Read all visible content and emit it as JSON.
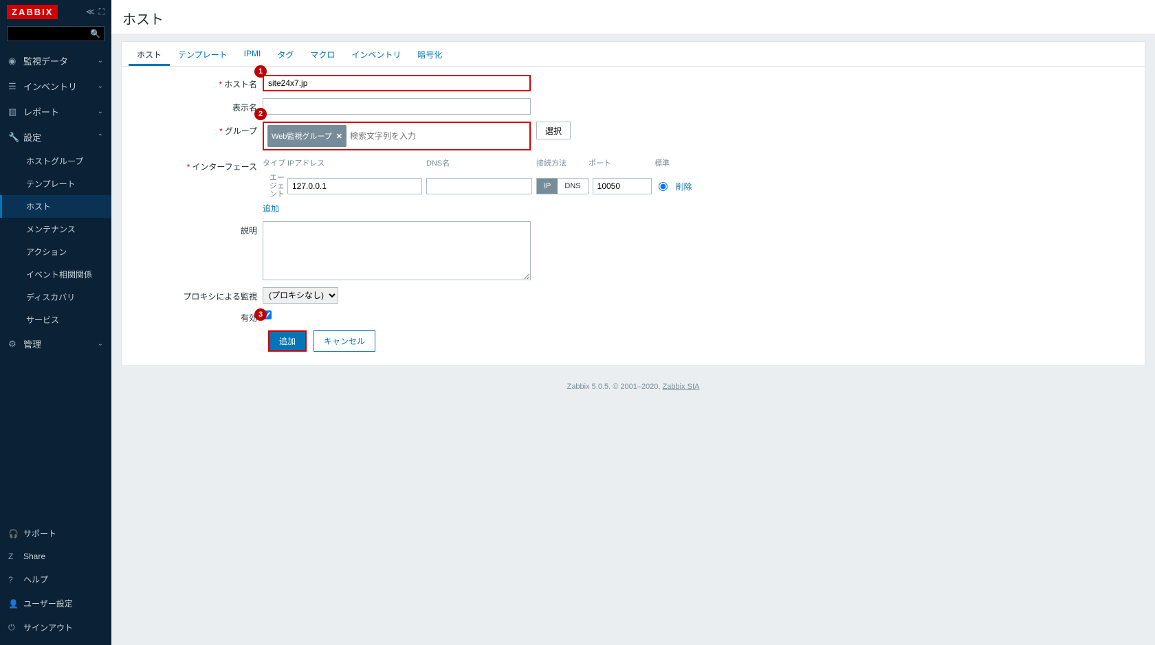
{
  "logo": "ZABBIX",
  "sidebar": {
    "items": [
      {
        "icon": "eye",
        "label": "監視データ",
        "chev": "down"
      },
      {
        "icon": "list",
        "label": "インベントリ",
        "chev": "down"
      },
      {
        "icon": "bar",
        "label": "レポート",
        "chev": "down"
      },
      {
        "icon": "wrench",
        "label": "設定",
        "chev": "up"
      },
      {
        "icon": "gear",
        "label": "管理",
        "chev": "down"
      }
    ],
    "config_sub": [
      {
        "label": "ホストグループ"
      },
      {
        "label": "テンプレート"
      },
      {
        "label": "ホスト",
        "active": true
      },
      {
        "label": "メンテナンス"
      },
      {
        "label": "アクション"
      },
      {
        "label": "イベント相関関係"
      },
      {
        "label": "ディスカバリ"
      },
      {
        "label": "サービス"
      }
    ],
    "bottom": [
      {
        "icon": "head",
        "label": "サポート"
      },
      {
        "icon": "share",
        "label": "Share"
      },
      {
        "icon": "help",
        "label": "ヘルプ"
      },
      {
        "icon": "user",
        "label": "ユーザー設定"
      },
      {
        "icon": "power",
        "label": "サインアウト"
      }
    ]
  },
  "page_title": "ホスト",
  "tabs": [
    {
      "label": "ホスト",
      "active": true
    },
    {
      "label": "テンプレート"
    },
    {
      "label": "IPMI"
    },
    {
      "label": "タグ"
    },
    {
      "label": "マクロ"
    },
    {
      "label": "インベントリ"
    },
    {
      "label": "暗号化"
    }
  ],
  "form": {
    "host_label": "ホスト名",
    "host_value": "site24x7.jp",
    "display_label": "表示名",
    "display_value": "",
    "group_label": "グループ",
    "group_tag": "Web監視グループ",
    "group_placeholder": "検索文字列を入力",
    "select_btn": "選択",
    "iface_label": "インターフェース",
    "iface_cols": {
      "type": "タイプ",
      "ip": "IPアドレス",
      "dns": "DNS名",
      "conn": "接続方法",
      "port": "ポート",
      "std": "標準"
    },
    "agent_label": "エージェント",
    "ip_value": "127.0.0.1",
    "dns_value": "",
    "conn_ip": "IP",
    "conn_dns": "DNS",
    "port_value": "10050",
    "delete": "削除",
    "add": "追加",
    "desc_label": "説明",
    "proxy_label": "プロキシによる監視",
    "proxy_value": "(プロキシなし)",
    "enabled_label": "有効",
    "submit": "追加",
    "cancel": "キャンセル"
  },
  "annotations": {
    "b1": "1",
    "b2": "2",
    "b3": "3"
  },
  "footer": {
    "text": "Zabbix 5.0.5. © 2001–2020, ",
    "link": "Zabbix SIA"
  }
}
